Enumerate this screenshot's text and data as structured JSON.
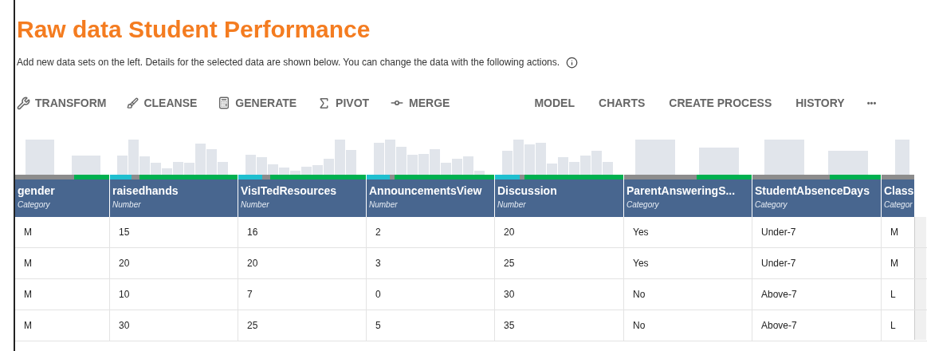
{
  "title": "Raw data Student Performance",
  "description": "Add new data sets on the left.  Details for the selected data are shown below.  You can change the data with the following actions.",
  "toolbar_left": [
    {
      "kind": "transform",
      "label": "TRANSFORM"
    },
    {
      "kind": "cleanse",
      "label": "CLEANSE"
    },
    {
      "kind": "generate",
      "label": "GENERATE"
    },
    {
      "kind": "pivot",
      "label": "PIVOT"
    },
    {
      "kind": "merge",
      "label": "MERGE"
    }
  ],
  "toolbar_right": [
    {
      "label": "MODEL"
    },
    {
      "label": "CHARTS"
    },
    {
      "label": "CREATE PROCESS"
    },
    {
      "label": "HISTORY"
    }
  ],
  "more": "•••",
  "columns": [
    {
      "name": "gender",
      "type": "Category",
      "quality_bar": {
        "valid": {
          "level": 0.37
        }
      }
    },
    {
      "name": "raisedhands",
      "type": "Number",
      "quality_bar": {
        "numeric": {
          "level": 0.17
        },
        "valid": {
          "level": 0.77
        }
      }
    },
    {
      "name": "VisITedResources",
      "type": "Number",
      "quality_bar": {
        "numeric": {
          "level": 0.19
        },
        "valid": {
          "level": 0.75
        }
      }
    },
    {
      "name": "AnnouncementsView",
      "type": "Number",
      "quality_bar": {
        "numeric": {
          "level": 0.18
        },
        "valid": {
          "level": 0.78
        }
      }
    },
    {
      "name": "Discussion",
      "type": "Number",
      "quality_bar": {
        "numeric": {
          "level": 0.19
        },
        "valid": {
          "level": 0.77
        }
      }
    },
    {
      "name": "ParentAnsweringS...",
      "type": "Category",
      "quality_bar": {
        "valid": {
          "level": 0.43
        }
      }
    },
    {
      "name": "StudentAbsenceDays",
      "type": "Category",
      "quality_bar": {
        "valid": {
          "level": 0.4
        }
      }
    },
    {
      "name": "Class",
      "type": "Categor"
    }
  ],
  "rows": [
    [
      "M",
      "15",
      "16",
      "2",
      "20",
      "Yes",
      "Under-7",
      "M"
    ],
    [
      "M",
      "20",
      "20",
      "3",
      "25",
      "Yes",
      "Under-7",
      "M"
    ],
    [
      "M",
      "10",
      "7",
      "0",
      "30",
      "No",
      "Above-7",
      "L"
    ],
    [
      "M",
      "30",
      "25",
      "5",
      "35",
      "No",
      "Above-7",
      "L"
    ]
  ]
}
